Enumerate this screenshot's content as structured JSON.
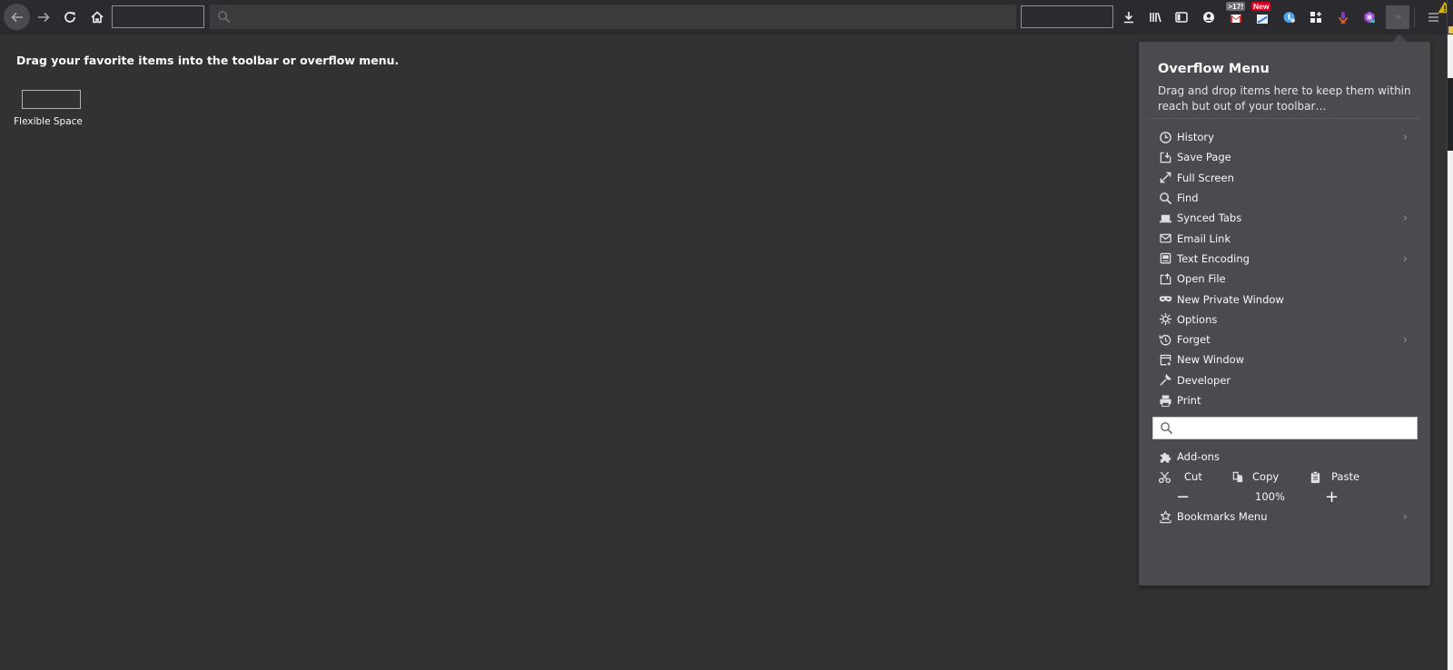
{
  "toolbar": {
    "back_icon": "arrow-left-icon",
    "forward_icon": "arrow-right-icon",
    "reload_icon": "reload-icon",
    "home_icon": "home-icon",
    "urlbar": {
      "value": "",
      "placeholder": "",
      "icon": "search-icon"
    },
    "right_icons": [
      {
        "name": "downloads-icon"
      },
      {
        "name": "library-icon"
      },
      {
        "name": "sidebar-icon"
      },
      {
        "name": "account-icon"
      },
      {
        "name": "gmail-extension-icon",
        "badge": ">17!"
      },
      {
        "name": "slides-extension-icon",
        "badge": "New"
      },
      {
        "name": "extension-icon"
      },
      {
        "name": "apps-icon"
      },
      {
        "name": "microphone-extension-icon"
      },
      {
        "name": "purple-extension-icon"
      }
    ],
    "overflow_label": "»",
    "menu_icon": "hamburger-menu-icon",
    "warning_icon": "warning-icon"
  },
  "content": {
    "hint": "Drag your favorite items into the toolbar or overflow menu.",
    "flexible_space_label": "Flexible Space"
  },
  "overflow_panel": {
    "title": "Overflow Menu",
    "description": "Drag and drop items here to keep them within reach but out of your toolbar…",
    "items": [
      {
        "label": "History",
        "icon": "clock-icon",
        "submenu": true
      },
      {
        "label": "Save Page",
        "icon": "save-page-icon",
        "submenu": false
      },
      {
        "label": "Full Screen",
        "icon": "fullscreen-icon",
        "submenu": false
      },
      {
        "label": "Find",
        "icon": "search-icon",
        "submenu": false
      },
      {
        "label": "Synced Tabs",
        "icon": "laptop-icon",
        "submenu": true
      },
      {
        "label": "Email Link",
        "icon": "envelope-icon",
        "submenu": false
      },
      {
        "label": "Text Encoding",
        "icon": "text-encoding-icon",
        "submenu": true
      },
      {
        "label": "Open File",
        "icon": "open-file-icon",
        "submenu": false
      },
      {
        "label": "New Private Window",
        "icon": "mask-icon",
        "submenu": false
      },
      {
        "label": "Options",
        "icon": "gear-icon",
        "submenu": false
      },
      {
        "label": "Forget",
        "icon": "forget-icon",
        "submenu": true
      },
      {
        "label": "New Window",
        "icon": "new-window-icon",
        "submenu": false
      },
      {
        "label": "Developer",
        "icon": "wrench-icon",
        "submenu": false
      },
      {
        "label": "Print",
        "icon": "printer-icon",
        "submenu": false
      }
    ],
    "search": {
      "value": "",
      "placeholder": ""
    },
    "addons_label": "Add-ons",
    "edit": {
      "cut": "Cut",
      "copy": "Copy",
      "paste": "Paste"
    },
    "zoom": {
      "out": "−",
      "value": "100%",
      "in": "+"
    },
    "bookmarks_label": "Bookmarks Menu",
    "chevron": "›"
  }
}
